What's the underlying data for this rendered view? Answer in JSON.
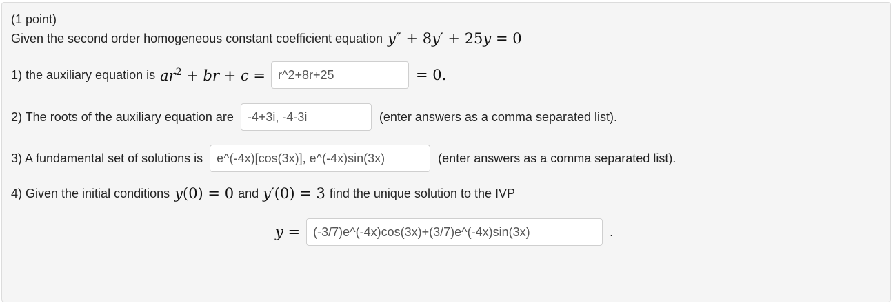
{
  "header": {
    "points": "(1 point)"
  },
  "intro": {
    "text": "Given the second order homogeneous constant coefficient equation",
    "equation": {
      "y": "y",
      "pp": "″",
      "plus1": " + 8",
      "y2": "y",
      "p": "′",
      "plus2": " + 25",
      "y3": "y",
      "eq": " = 0"
    }
  },
  "q1": {
    "label": "1) the auxiliary equation is",
    "math": {
      "a": "ar",
      "exp": "2",
      "rest": " + br + c ="
    },
    "answer": "r^2+8r+25",
    "suffix": "= 0."
  },
  "q2": {
    "label": "2) The roots of the auxiliary equation are",
    "answer": "-4+3i, -4-3i",
    "hint": "(enter answers as a comma separated list)."
  },
  "q3": {
    "label": "3) A fundamental set of solutions is",
    "answer": "e^(-4x)[cos(3x)], e^(-4x)sin(3x)",
    "hint": "(enter answers as a comma separated list)."
  },
  "q4": {
    "label": "4) Given the initial conditions",
    "cond1": {
      "y": "y",
      "rest": "(0) = 0"
    },
    "and": "and",
    "cond2": {
      "y": "y",
      "p": "′",
      "rest": "(0) = 3"
    },
    "tail": "find the unique solution to the IVP",
    "lhs": "y =",
    "answer": "(-3/7)e^(-4x)cos(3x)+(3/7)e^(-4x)sin(3x)",
    "period": "."
  }
}
